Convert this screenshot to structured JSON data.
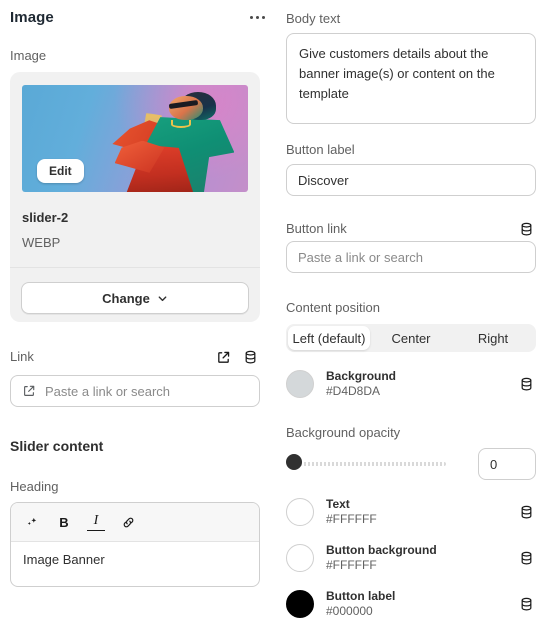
{
  "header": {
    "title": "Image",
    "more_menu_icon": "more-horizontal-icon"
  },
  "left": {
    "image_label": "Image",
    "image_card": {
      "edit_button": "Edit",
      "file_name": "slider-2",
      "file_type": "WEBP",
      "change_button": "Change",
      "change_chevron_icon": "chevron-down-icon"
    },
    "link": {
      "label": "Link",
      "external_icon": "external-link-icon",
      "metafield_icon": "database-icon",
      "input_icon": "external-link-icon",
      "placeholder": "Paste a link or search",
      "value": ""
    },
    "slider_content": {
      "title": "Slider content",
      "heading_label": "Heading",
      "toolbar": [
        {
          "icon": "sparkle-icon",
          "glyph": ""
        },
        {
          "icon": "bold-icon",
          "glyph": "B"
        },
        {
          "icon": "italic-icon",
          "glyph": "I"
        },
        {
          "icon": "link-icon",
          "glyph": ""
        }
      ],
      "heading_value": "Image Banner"
    }
  },
  "right": {
    "body_text": {
      "label": "Body text",
      "value": "Give customers details about the banner image(s) or content on the template"
    },
    "button_label": {
      "label": "Button label",
      "value": "Discover"
    },
    "button_link": {
      "label": "Button link",
      "metafield_icon": "database-icon",
      "placeholder": "Paste a link or search",
      "value": ""
    },
    "content_position": {
      "label": "Content position",
      "options": [
        "Left (default)",
        "Center",
        "Right"
      ],
      "selected_index": 0
    },
    "background_color": {
      "name": "Background",
      "hex": "#D4D8DA",
      "metafield_icon": "database-icon"
    },
    "background_opacity": {
      "label": "Background opacity",
      "value": "0",
      "min": 0,
      "max": 100,
      "thumb_percent": 0
    },
    "colors": [
      {
        "name": "Text",
        "hex": "#FFFFFF",
        "metafield_icon": "database-icon"
      },
      {
        "name": "Button background",
        "hex": "#FFFFFF",
        "metafield_icon": "database-icon"
      },
      {
        "name": "Button label",
        "hex": "#000000",
        "metafield_icon": "database-icon"
      }
    ]
  }
}
